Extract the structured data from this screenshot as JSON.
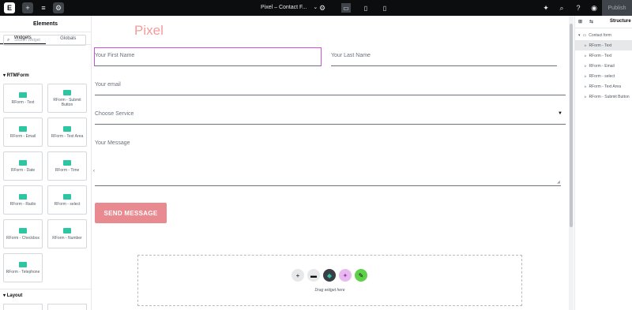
{
  "topbar": {
    "title": "Pixel – Contact F...",
    "publish_label": "Publish"
  },
  "left_panel": {
    "header": "Elements",
    "tabs": [
      "Widgets",
      "Globals"
    ],
    "search_placeholder": "Search Widget",
    "section_rtmform": "RTMForm",
    "section_layout": "Layout",
    "widgets": [
      "RForm - Text",
      "RForm - Submit Button",
      "RForm - Email",
      "RForm - Text Area",
      "RForm - Date",
      "RForm - Time",
      "RForm - Radio",
      "RForm - select",
      "RForm - Checkbox",
      "RForm - Number",
      "RForm - Telephone"
    ]
  },
  "form": {
    "brand": "Pixel",
    "first_name_placeholder": "Your First Name",
    "last_name_placeholder": "Your Last Name",
    "email_placeholder": "Your email",
    "service_placeholder": "Choose Service",
    "message_placeholder": "Your Message",
    "submit_label": "SEND MESSAGE",
    "drop_text": "Drag widget here"
  },
  "structure": {
    "header": "Structure",
    "root": "Contact form",
    "items": [
      "RForm - Text",
      "RForm - Text",
      "RForm - Email",
      "RForm - select",
      "RForm - Text Area",
      "RForm - Submit Button"
    ]
  },
  "colors": {
    "brand": "#f59b99",
    "submit": "#e88a8f",
    "widget_icon": "#2ec5a3",
    "selected_outline": "#d04fe0"
  },
  "icons": {
    "app_logo": "elementor-logo-icon",
    "add": "plus-icon",
    "structure": "layers-icon",
    "settings": "gear-icon"
  }
}
